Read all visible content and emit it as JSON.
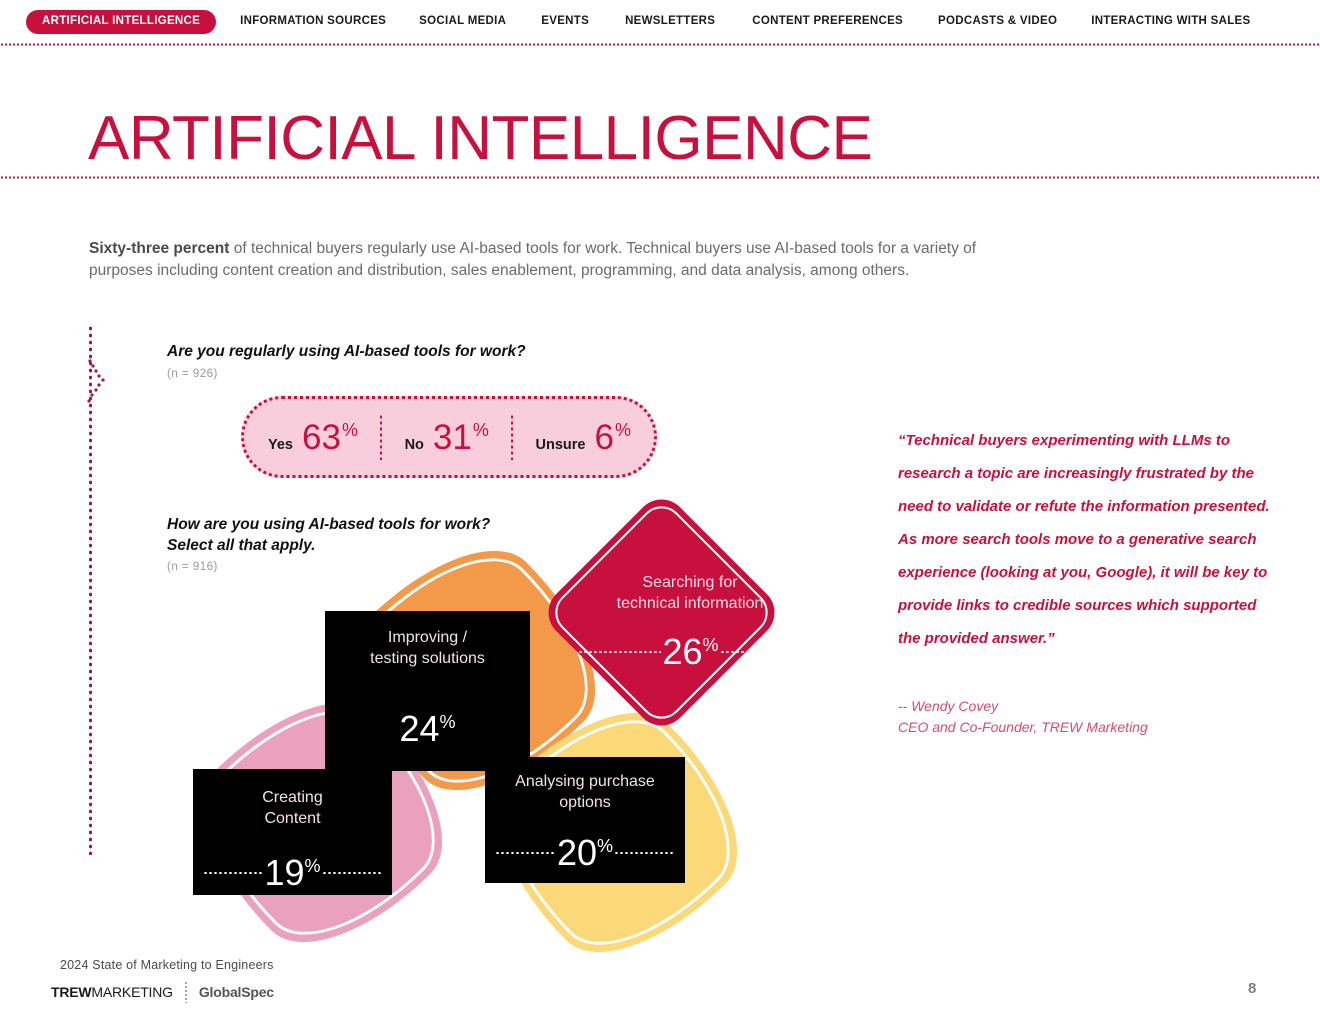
{
  "nav": {
    "active": "ARTIFICIAL INTELLIGENCE",
    "items": [
      "INFORMATION SOURCES",
      "SOCIAL MEDIA",
      "EVENTS",
      "NEWSLETTERS",
      "CONTENT PREFERENCES",
      "PODCASTS & VIDEO",
      "INTERACTING WITH SALES"
    ]
  },
  "page": {
    "title": "ARTIFICIAL INTELLIGENCE",
    "intro_bold": "Sixty-three percent",
    "intro_rest": " of technical buyers regularly use AI-based tools for work. Technical buyers use AI-based tools for a variety of purposes including content creation and distribution, sales enablement, programming, and data analysis, among others."
  },
  "q1": {
    "title": "Are you regularly using AI-based tools for work?",
    "n": "(n  = 926)",
    "segments": [
      {
        "label": "Yes",
        "value": "63",
        "pct": "%"
      },
      {
        "label": "No",
        "value": "31",
        "pct": "%"
      },
      {
        "label": "Unsure",
        "value": "6",
        "pct": "%"
      }
    ]
  },
  "q2": {
    "title": "How are you using AI-based tools for work?\nSelect all that apply.",
    "n": "(n  = 916)",
    "items": [
      {
        "label": "Searching for\ntechnical information",
        "value": "26",
        "pct": "%",
        "color": "#C8103E"
      },
      {
        "label": "Improving /\ntesting solutions",
        "value": "24",
        "pct": "%",
        "color": "#F2994A"
      },
      {
        "label": "Analysing purchase\noptions",
        "value": "20",
        "pct": "%",
        "color": "#FBD979"
      },
      {
        "label": "Creating\nContent",
        "value": "19",
        "pct": "%",
        "color": "#E9A1BE"
      }
    ]
  },
  "chart_data": {
    "type": "pie",
    "title": "How are you using AI-based tools for work? Select all that apply.",
    "categories": [
      "Searching for technical information",
      "Improving / testing solutions",
      "Analysing purchase options",
      "Creating Content"
    ],
    "values": [
      26,
      24,
      20,
      19
    ],
    "unit": "%",
    "n": 916,
    "legend": "none",
    "grid": false,
    "secondary": {
      "type": "bar",
      "title": "Are you regularly using AI-based tools for work?",
      "categories": [
        "Yes",
        "No",
        "Unsure"
      ],
      "values": [
        63,
        31,
        6
      ],
      "unit": "%",
      "n": 926
    }
  },
  "quote": {
    "text": "“Technical buyers experimenting with LLMs to research a topic are increasingly frustrated by the need to validate or refute the information presented. As more search tools move to a generative search experience (looking at you, Google), it will be key to provide links to credible sources which supported the provided answer.”",
    "attribution": "-- Wendy Covey\n    CEO and Co-Founder, TREW Marketing"
  },
  "footer": {
    "report_title": "2024 State of Marketing to Engineers",
    "logo_trew_bold": "TREW",
    "logo_trew_light": "MARKETING",
    "logo_globalspec": "GlobalSpec",
    "page_number": "8"
  },
  "colors": {
    "brand_crimson": "#C8103E",
    "pill_bg": "#F8CEDC",
    "petal_orange": "#F2994A",
    "petal_pink": "#E9A1BE",
    "petal_yellow": "#FBD979"
  }
}
